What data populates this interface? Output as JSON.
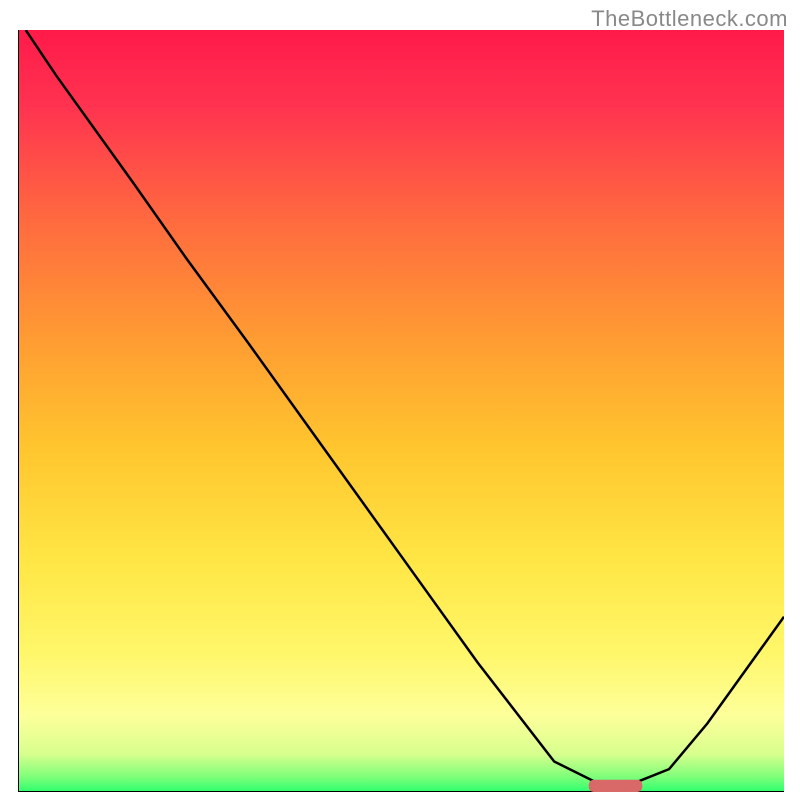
{
  "watermark_text": "TheBottleneck.com",
  "chart_data": {
    "type": "line",
    "title": "",
    "xlabel": "",
    "ylabel": "",
    "x_range": [
      0,
      100
    ],
    "y_range": [
      0,
      100
    ],
    "series": [
      {
        "name": "curve",
        "x": [
          1,
          5,
          15,
          22,
          30,
          40,
          50,
          60,
          70,
          76,
          80,
          85,
          90,
          100
        ],
        "y": [
          100,
          94,
          80,
          70,
          59,
          45,
          31,
          17,
          4,
          1,
          1,
          3,
          9,
          23
        ]
      }
    ],
    "marker": {
      "x_center": 78,
      "y_center": 0.8,
      "width": 7,
      "height": 1.6,
      "color": "#d96868"
    },
    "axes_visible": {
      "left": true,
      "bottom": true,
      "right": false,
      "top": false
    },
    "grid": false,
    "background_gradient": {
      "type": "vertical",
      "stops": [
        {
          "offset": 0.0,
          "color": "#ff1a4a"
        },
        {
          "offset": 0.1,
          "color": "#ff3350"
        },
        {
          "offset": 0.25,
          "color": "#ff6a3f"
        },
        {
          "offset": 0.4,
          "color": "#ff9a33"
        },
        {
          "offset": 0.55,
          "color": "#ffc62e"
        },
        {
          "offset": 0.7,
          "color": "#ffe746"
        },
        {
          "offset": 0.82,
          "color": "#fff76b"
        },
        {
          "offset": 0.9,
          "color": "#fdff9a"
        },
        {
          "offset": 0.95,
          "color": "#d8ff8e"
        },
        {
          "offset": 0.98,
          "color": "#7fff7a"
        },
        {
          "offset": 1.0,
          "color": "#2dff6e"
        }
      ]
    }
  }
}
